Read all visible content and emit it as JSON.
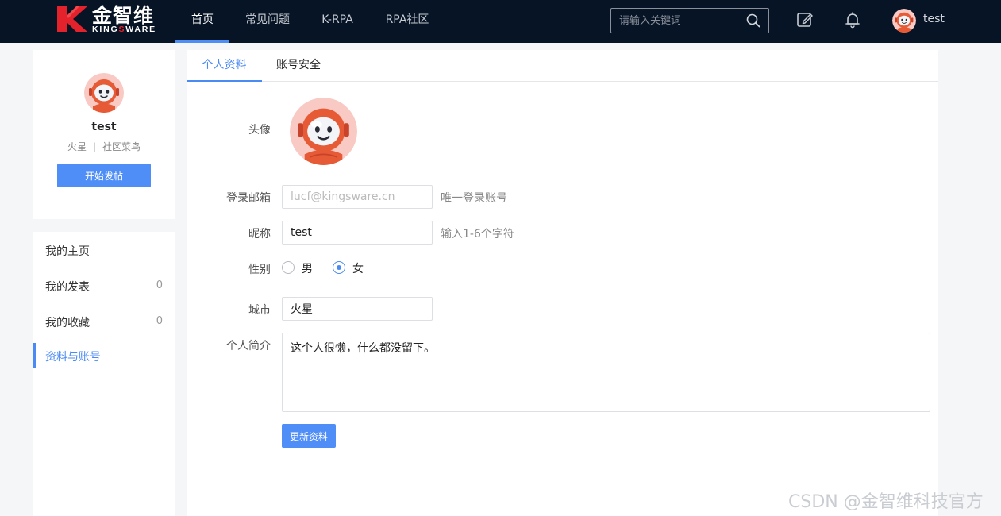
{
  "brand": {
    "name_cn": "金智维",
    "name_en_prefix": "KING",
    "name_en_accent": "S",
    "name_en_suffix": "WARE",
    "accent_color": "#e4222b"
  },
  "nav": {
    "items": [
      {
        "label": "首页",
        "active": true
      },
      {
        "label": "常见问题",
        "active": false
      },
      {
        "label": "K-RPA",
        "active": false
      },
      {
        "label": "RPA社区",
        "active": false
      }
    ],
    "search_placeholder": "请输入关键词",
    "icons": [
      "edit-icon",
      "bell-icon",
      "search-icon"
    ],
    "username": "test"
  },
  "profile": {
    "name": "test",
    "city": "火星",
    "level": "社区菜鸟",
    "post_button": "开始发帖"
  },
  "menu": {
    "items": [
      {
        "label": "我的主页",
        "count": ""
      },
      {
        "label": "我的发表",
        "count": "0"
      },
      {
        "label": "我的收藏",
        "count": "0"
      },
      {
        "label": "资料与账号",
        "count": "",
        "active": true
      }
    ]
  },
  "tabs": [
    {
      "label": "个人资料",
      "active": true
    },
    {
      "label": "账号安全",
      "active": false
    }
  ],
  "form": {
    "avatar_label": "头像",
    "email_label": "登录邮箱",
    "email_value": "lucf@kingsware.cn",
    "email_hint": "唯一登录账号",
    "nickname_label": "昵称",
    "nickname_value": "test",
    "nickname_hint": "输入1-6个字符",
    "gender_label": "性别",
    "gender_options": [
      "男",
      "女"
    ],
    "gender_selected": "女",
    "city_label": "城市",
    "city_value": "火星",
    "bio_label": "个人简介",
    "bio_value": "这个人很懒，什么都没留下。",
    "submit_label": "更新资料"
  },
  "watermark": "CSDN @金智维科技官方",
  "colors": {
    "topbar": "#071426",
    "primary": "#4f8ef7",
    "active_text": "#4a8af4",
    "page_bg": "#f5f6f8"
  }
}
